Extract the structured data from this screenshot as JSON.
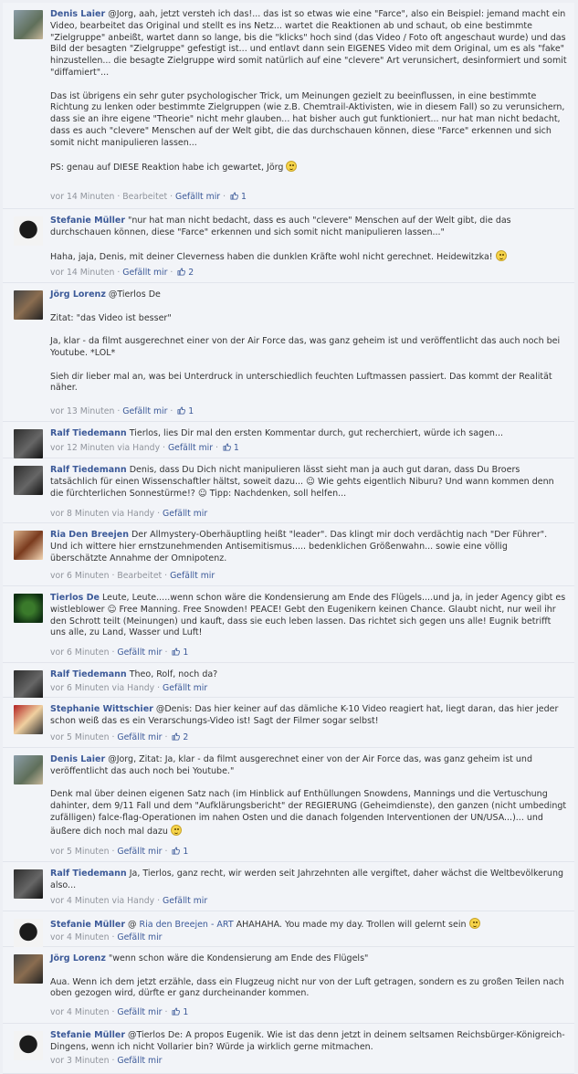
{
  "comments": [
    {
      "author": "Denis Laier",
      "text": " @Jorg, aah, jetzt versteh ich das!... das ist so etwas wie eine \"Farce\", also ein Beispiel: jemand macht ein Video, bearbeitet das Original und stellt es ins Netz... wartet die Reaktionen ab und schaut, ob eine bestimmte \"Zielgruppe\" anbeißt, wartet dann so lange, bis die \"klicks\" hoch sind (das Video / Foto oft angeschaut wurde) und das Bild der besagten \"Zielgruppe\" gefestigt ist... und entlavt dann sein EIGENES Video mit dem Original, um es als \"fake\" hinzustellen... die besagte Zielgruppe wird somit natürlich auf eine \"clevere\" Art verunsichert, desinformiert und somit \"diffamiert\"...\n\nDas ist übrigens ein sehr guter psychologischer Trick, um Meinungen gezielt zu beeinflussen, in eine bestimmte Richtung zu lenken oder bestimmte Zielgruppen (wie z.B. Chemtrail-Aktivisten, wie in diesem Fall) so zu verunsichern, dass sie an ihre eigene \"Theorie\" nicht mehr glauben... hat bisher auch gut funktioniert... nur hat man nicht bedacht, dass es auch \"clevere\" Menschen auf der Welt gibt, die das durchschauen können, diese \"Farce\" erkennen und sich somit nicht manipulieren lassen...\n\nPS: genau auf DIESE Reaktion habe ich gewartet, Jörg ",
      "smiley_end": true,
      "time": "vor 14 Minuten",
      "extra": "Bearbeitet",
      "action": "Gefällt mir",
      "likes": "1"
    },
    {
      "author": "Stefanie Müller",
      "text": " \"nur hat man nicht bedacht, dass es auch \"clevere\" Menschen auf der Welt gibt, die das durchschauen können, diese \"Farce\" erkennen und sich somit nicht manipulieren lassen...\"\n\nHaha, jaja, Denis, mit deiner Cleverness haben die dunklen Kräfte wohl nicht gerechnet. Heidewitzka! ",
      "smiley_end": true,
      "time": "vor 14 Minuten",
      "extra": "",
      "action": "Gefällt mir",
      "likes": "2"
    },
    {
      "author": "Jörg Lorenz",
      "text": " @Tierlos De\n\nZitat: \"das Video ist besser\"\n\nJa, klar - da filmt ausgerechnet einer von der Air Force das, was ganz geheim ist und veröffentlicht das auch noch bei Youtube. *LOL*\n\nSieh dir lieber mal an, was bei Unterdruck in unterschiedlich feuchten Luftmassen passiert. Das kommt der Realität näher.",
      "smiley_end": false,
      "time": "vor 13 Minuten",
      "extra": "",
      "action": "Gefällt mir",
      "likes": "1"
    },
    {
      "author": "Ralf Tiedemann",
      "text": " Tierlos, lies Dir mal den ersten Kommentar durch, gut recherchiert, würde ich sagen...",
      "smiley_end": false,
      "time": "vor 12 Minuten via Handy",
      "extra": "",
      "action": "Gefällt mir",
      "likes": "1"
    },
    {
      "author": "Ralf Tiedemann",
      "text": " Denis, dass Du Dich nicht manipulieren lässt sieht man ja auch gut daran, dass Du Broers tatsächlich für einen Wissenschaftler hältst, soweit dazu... ☺ Wie gehts eigentlich Niburu? Und wann kommen denn die fürchterlichen Sonnestürme!? ☺ Tipp: Nachdenken, soll helfen...",
      "smiley_end": false,
      "time": "vor 8 Minuten via Handy",
      "extra": "",
      "action": "Gefällt mir",
      "likes": ""
    },
    {
      "author": "Ria Den Breejen",
      "text": " Der Allmystery-Oberhäuptling heißt \"leader\". Das klingt mir doch verdächtig nach \"Der Führer\". Und ich wittere hier ernstzunehmenden Antisemitismus..... bedenklichen Größenwahn... sowie eine völlig überschätzte Annahme der Omnipotenz.",
      "smiley_end": false,
      "time": "vor 6 Minuten",
      "extra": "Bearbeitet",
      "action": "Gefällt mir",
      "likes": ""
    },
    {
      "author": "Tierlos De",
      "text": " Leute, Leute.....wenn schon wäre die Kondensierung am Ende des Flügels....und ja, in jeder Agency gibt es wistleblower ☺ Free Manning. Free Snowden! PEACE! Gebt den Eugenikern keinen Chance. Glaubt nicht, nur weil ihr den Schrott teilt (Meinungen) und kauft, dass sie euch leben lassen. Das richtet sich gegen uns alle! Eugnik betrifft uns alle, zu Land, Wasser und Luft!",
      "smiley_end": false,
      "time": "vor 6 Minuten",
      "extra": "",
      "action": "Gefällt mir",
      "likes": "1"
    },
    {
      "author": "Ralf Tiedemann",
      "text": " Theo, Rolf, noch da?",
      "smiley_end": false,
      "time": "vor 6 Minuten via Handy",
      "extra": "",
      "action": "Gefällt mir",
      "likes": ""
    },
    {
      "author": "Stephanie Wittschier",
      "text": " @Denis: Das hier keiner auf das dämliche K-10 Video reagiert hat, liegt daran, das hier jeder schon weiß das es ein Verarschungs-Video ist! Sagt der Filmer sogar selbst!",
      "smiley_end": false,
      "time": "vor 5 Minuten",
      "extra": "",
      "action": "Gefällt mir",
      "likes": "2"
    },
    {
      "author": "Denis Laier",
      "text": " @Jorg, Zitat: Ja, klar - da filmt ausgerechnet einer von der Air Force das, was ganz geheim ist und veröffentlicht das auch noch bei Youtube.\"\n\nDenk mal über deinen eigenen Satz nach (im Hinblick auf Enthüllungen Snowdens, Mannings und die Vertuschung dahinter, dem 9/11 Fall und dem \"Aufklärungsbericht\" der REGIERUNG (Geheimdienste), den ganzen (nicht umbedingt zufälligen) falce-flag-Operationen im nahen Osten und die danach folgenden Interventionen der UN/USA...)... und äußere dich noch mal dazu ",
      "smiley_end": true,
      "time": "vor 5 Minuten",
      "extra": "",
      "action": "Gefällt mir",
      "likes": "1"
    },
    {
      "author": "Ralf Tiedemann",
      "text": " Ja, Tierlos, ganz recht, wir werden seit Jahrzehnten alle vergiftet, daher wächst die Weltbevölkerung also...",
      "smiley_end": false,
      "time": "vor 4 Minuten via Handy",
      "extra": "",
      "action": "Gefällt mir",
      "likes": ""
    },
    {
      "author": "Stefanie Müller",
      "text": " @ ",
      "mention": "Ria den Breejen - ART",
      "text2": " AHAHAHA. You made my day. Trollen will gelernt sein ",
      "smiley_end": true,
      "time": "vor 4 Minuten",
      "extra": "",
      "action": "Gefällt mir",
      "likes": ""
    },
    {
      "author": "Jörg Lorenz",
      "text": " \"wenn schon wäre die Kondensierung am Ende des Flügels\"\n\nAua. Wenn ich dem jetzt erzähle, dass ein Flugzeug nicht nur von der Luft getragen, sondern es zu großen Teilen nach oben gezogen wird, dürfte er ganz durcheinander kommen.",
      "smiley_end": false,
      "time": "vor 4 Minuten",
      "extra": "",
      "action": "Gefällt mir",
      "likes": "1"
    },
    {
      "author": "Stefanie Müller",
      "text": " @Tierlos De: A propos Eugenik. Wie ist das denn jetzt in deinem seltsamen Reichsbürger-Königreich-Dingens, wenn ich nicht Vollarier bin? Würde ja wirklich gerne mitmachen.",
      "smiley_end": false,
      "time": "vor 3 Minuten",
      "extra": "",
      "action": "Gefällt mir",
      "likes": ""
    }
  ],
  "avatar_icons": [
    "person-photo",
    "balaclava",
    "camera-person",
    "dark-person",
    "dark-person",
    "woman-portrait",
    "tree-logo",
    "dark-person",
    "cartoon",
    "person-photo",
    "dark-person",
    "balaclava",
    "camera-person",
    "balaclava"
  ]
}
